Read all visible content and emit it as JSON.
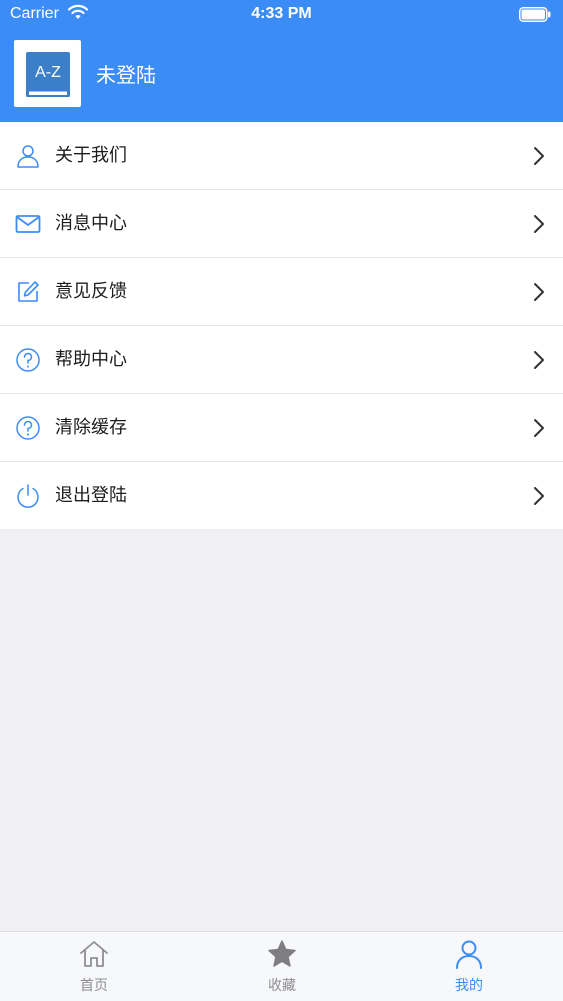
{
  "status_bar": {
    "carrier": "Carrier",
    "time": "4:33 PM"
  },
  "profile": {
    "name": "未登陆",
    "avatar_icon": "dictionary-az-icon",
    "avatar_text": "A-Z"
  },
  "menu": {
    "items": [
      {
        "label": "关于我们",
        "icon": "person-icon"
      },
      {
        "label": "消息中心",
        "icon": "mail-icon"
      },
      {
        "label": "意见反馈",
        "icon": "edit-icon"
      },
      {
        "label": "帮助中心",
        "icon": "help-icon"
      },
      {
        "label": "清除缓存",
        "icon": "help-icon"
      },
      {
        "label": "退出登陆",
        "icon": "power-icon"
      }
    ]
  },
  "tabbar": {
    "items": [
      {
        "label": "首页",
        "icon": "home-icon"
      },
      {
        "label": "收藏",
        "icon": "star-icon"
      },
      {
        "label": "我的",
        "icon": "person-icon",
        "active": true
      }
    ]
  },
  "colors": {
    "accent": "#3b8cf7",
    "background": "#efeff4",
    "tab_inactive": "#8e8e93"
  }
}
